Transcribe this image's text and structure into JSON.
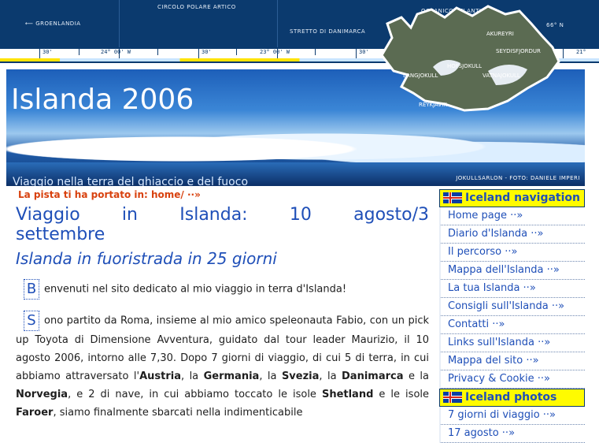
{
  "header": {
    "labels": {
      "groenlandia": "⟵ GROENLANDIA",
      "circolo": "CIRCOLO POLARE ARTICO",
      "stretto": "STRETTO DI DANIMARCA",
      "oceano": "OCEANICO ATLANTICO",
      "lat": "66° N",
      "akureyri": "AKUREYRI",
      "seydisfjordur": "SEYDISFJORDUR",
      "hofsjokull": "HOFSJOKULL",
      "langjokull": "LANGJOKULL",
      "vatnajokull": "VATNAJOKULL",
      "reykjavik": "REYKJAVIK"
    },
    "ruler": [
      "30'",
      "24° 00' W",
      "30'",
      "23° 00' W",
      "30'",
      "21°"
    ]
  },
  "banner": {
    "title": "Islanda 2006",
    "subtitle": "Viaggio nella terra del ghiaccio e del fuoco",
    "credit": "JOKULLSARLON - FOTO: DANIELE IMPERI"
  },
  "content": {
    "breadcrumb": "La pista ti ha portato in: home/ ··»",
    "title_line1": "Viaggio in Islanda: 10 agosto/3",
    "title_line2": "settembre",
    "subtitle": "Islanda in fuoristrada in 25 giorni",
    "p1_drop": "B",
    "p1_text": "envenuti nel sito dedicato al mio viaggio in terra d'Islanda!",
    "p2_drop": "S",
    "p2_a": "ono partito da Roma, insieme al mio amico speleonauta Fabio, con un pick up Toyota di Dimensione Avventura, guidato dal tour leader Maurizio, il 10 agosto 2006, intorno alle 7,30. Dopo 7 giorni di viaggio, di cui 5 di terra, in cui abbiamo attraversato l'",
    "austria": "Austria",
    "sep1": ", la ",
    "germania": "Germania",
    "sep2": ", la ",
    "svezia": "Svezia",
    "sep3": ", la ",
    "danimarca": "Danimarca",
    "sep4": " e la ",
    "norvegia": "Norvegia",
    "p2_b": ", e 2 di nave, in cui abbiamo toccato le isole ",
    "shetland": "Shetland",
    "p2_c": " e le isole ",
    "faroer": "Faroer",
    "p2_d": ", siamo finalmente sbarcati nella indimenticabile"
  },
  "sidebar": {
    "nav_title": "Iceland navigation",
    "items": [
      "Home page ··»",
      "Diario d'Islanda ··»",
      "Il percorso ··»",
      "Mappa dell'Islanda ··»",
      "La tua Islanda ··»",
      "Consigli sull'Islanda ··»",
      "Contatti ··»",
      "Links sull'Islanda ··»",
      "Mappa del sito ··»",
      "Privacy & Cookie ··»"
    ],
    "photos_title": "Iceland photos",
    "photo_items": [
      "7 giorni di viaggio ··»",
      "17 agosto ··»"
    ]
  },
  "colors": {
    "header_bg": "#0b3a6e",
    "link": "#1f4fb8",
    "accent": "#d8410e",
    "nav_head": "#fffb00"
  }
}
